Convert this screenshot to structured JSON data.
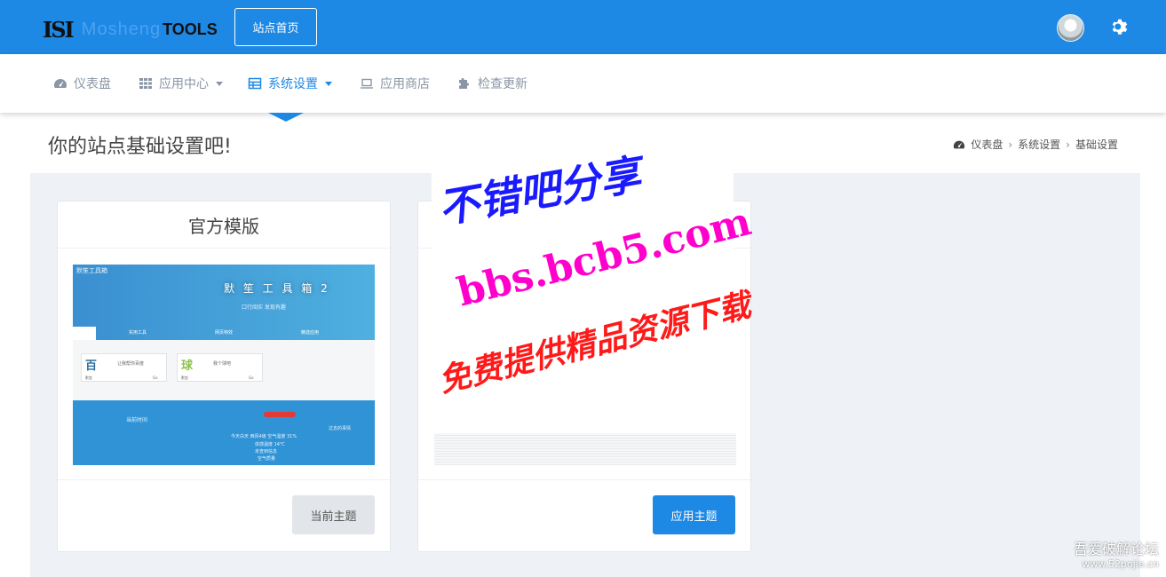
{
  "topbar": {
    "logo_mark": "ISI",
    "logo_light": "Mosheng",
    "logo_bold": "TOOLS",
    "home_button": "站点首页"
  },
  "nav": {
    "items": [
      {
        "label": "仪表盘",
        "icon": "dashboard-icon",
        "dropdown": false
      },
      {
        "label": "应用中心",
        "icon": "grid-icon",
        "dropdown": true
      },
      {
        "label": "系统设置",
        "icon": "table-icon",
        "dropdown": true,
        "active": true
      },
      {
        "label": "应用商店",
        "icon": "laptop-icon",
        "dropdown": false
      },
      {
        "label": "检查更新",
        "icon": "puzzle-icon",
        "dropdown": false
      }
    ]
  },
  "page": {
    "title": "你的站点基础设置吧!",
    "breadcrumb": [
      "仪表盘",
      "系统设置",
      "基础设置"
    ]
  },
  "cards": [
    {
      "title": "官方模版",
      "button": "当前主题",
      "preview": {
        "brand": "默笙工具箱",
        "headline": "默 笙 工 具 箱 2",
        "sub": "口行阅实 发现有趣",
        "tabs": [
          "实用工具",
          "网页特效",
          "精选应用"
        ],
        "boxes": [
          {
            "glyph": "百",
            "label": "让我帮你百度",
            "foot": "默笙",
            "go": "Go"
          },
          {
            "glyph": "球",
            "label": "我个球吧",
            "foot": "默笙",
            "go": "Go"
          }
        ],
        "time_label": "当前时间",
        "weather_line": "今天白天 西风4级 空气湿度 31%",
        "temp_line": "体感温度 14℃",
        "extra_lines": [
          "未查到信息",
          "空气质量"
        ],
        "side_note": "过去的事情"
      }
    },
    {
      "title": "",
      "button": "应用主题"
    }
  ],
  "watermark": {
    "line1": "不错吧分享",
    "line2": "bbs.bcb5.com",
    "line3": "免费提供精品资源下载",
    "corner1": "吾爱破解论坛",
    "corner2": "www.52pojie.cn"
  },
  "colors": {
    "primary": "#1e88e5",
    "content_bg": "#eef1f5",
    "nav_text": "#8a96a6"
  }
}
